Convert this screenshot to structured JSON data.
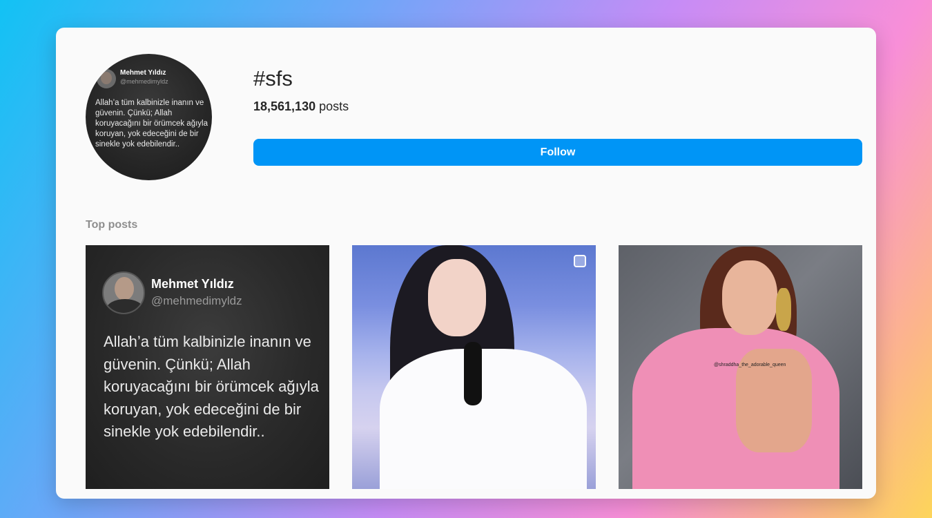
{
  "hashtag": {
    "title": "#sfs",
    "post_count": "18,561,130",
    "post_suffix": " posts",
    "follow_label": "Follow"
  },
  "avatar": {
    "name": "Mehmet Yıldız",
    "handle": "@mehmedimyldz",
    "quote": "Allah’a tüm kalbinizle inanın ve güvenin. Çünkü; Allah koruyacağını bir örümcek ağıyla koruyan, yok edeceğini de bir sinekle yok edebilendir.."
  },
  "section": {
    "title": "Top posts"
  },
  "posts": [
    {
      "name": "Mehmet Yıldız",
      "handle": "@mehmedimyldz",
      "quote": "Allah’a tüm kalbinizle inanın ve güvenin. Çünkü; Allah koruyacağını bir örümcek ağıyla koruyan, yok edeceğini de bir sinekle yok edebilendir.."
    },
    {
      "icon": "multiple-images-icon"
    },
    {
      "watermark": "@shraddha_the_adorable_queen"
    }
  ],
  "colors": {
    "accent": "#0095f6",
    "card": "#fafafa",
    "text": "#262626",
    "muted": "#8e8e8e"
  }
}
